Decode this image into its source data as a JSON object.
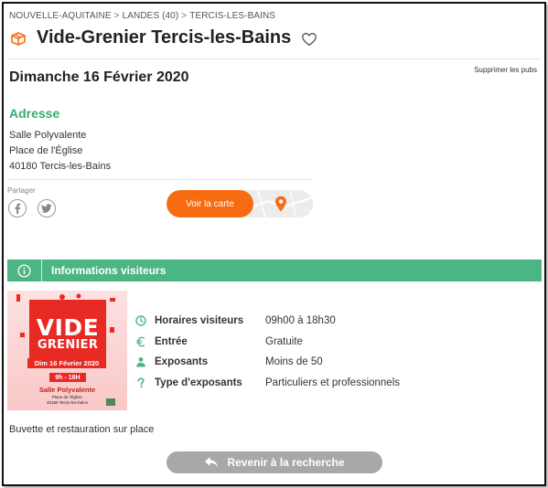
{
  "breadcrumb": {
    "items": [
      "NOUVELLE-AQUITAINE",
      "LANDES (40)",
      "TERCIS-LES-BAINS"
    ],
    "separator": ">"
  },
  "page": {
    "title": "Vide-Grenier Tercis-les-Bains",
    "date": "Dimanche 16 Février 2020",
    "ads_link": "Supprimer les pubs"
  },
  "address": {
    "title": "Adresse",
    "line1": "Salle Polyvalente",
    "line2": "Place de l'Église",
    "line3": "40180 Tercis-les-Bains"
  },
  "share": {
    "label": "Partager"
  },
  "map": {
    "button_label": "Voir la carte"
  },
  "info": {
    "title": "Informations visiteurs",
    "rows": [
      {
        "label": "Horaires visiteurs",
        "value": "09h00 à 18h30",
        "icon": "clock-icon"
      },
      {
        "label": "Entrée",
        "value": "Gratuite",
        "icon": "euro-icon"
      },
      {
        "label": "Exposants",
        "value": "Moins de 50",
        "icon": "person-icon"
      },
      {
        "label": "Type d'exposants",
        "value": "Particuliers et professionnels",
        "icon": "question-icon"
      }
    ]
  },
  "poster": {
    "title1": "VIDE",
    "title2": "GRENIER",
    "date": "Dim 16 Février 2020",
    "hours": "9h - 18H",
    "venue": "Salle Polyvalente",
    "place": "Place de l'Église",
    "town": "40180 Tercis-les-bains"
  },
  "extra": {
    "note": "Buvette et restauration sur place"
  },
  "actions": {
    "back_label": "Revenir à la recherche"
  },
  "colors": {
    "accent_green": "#4cb584",
    "accent_orange": "#f76c10",
    "grey_button": "#a8a8a8"
  }
}
